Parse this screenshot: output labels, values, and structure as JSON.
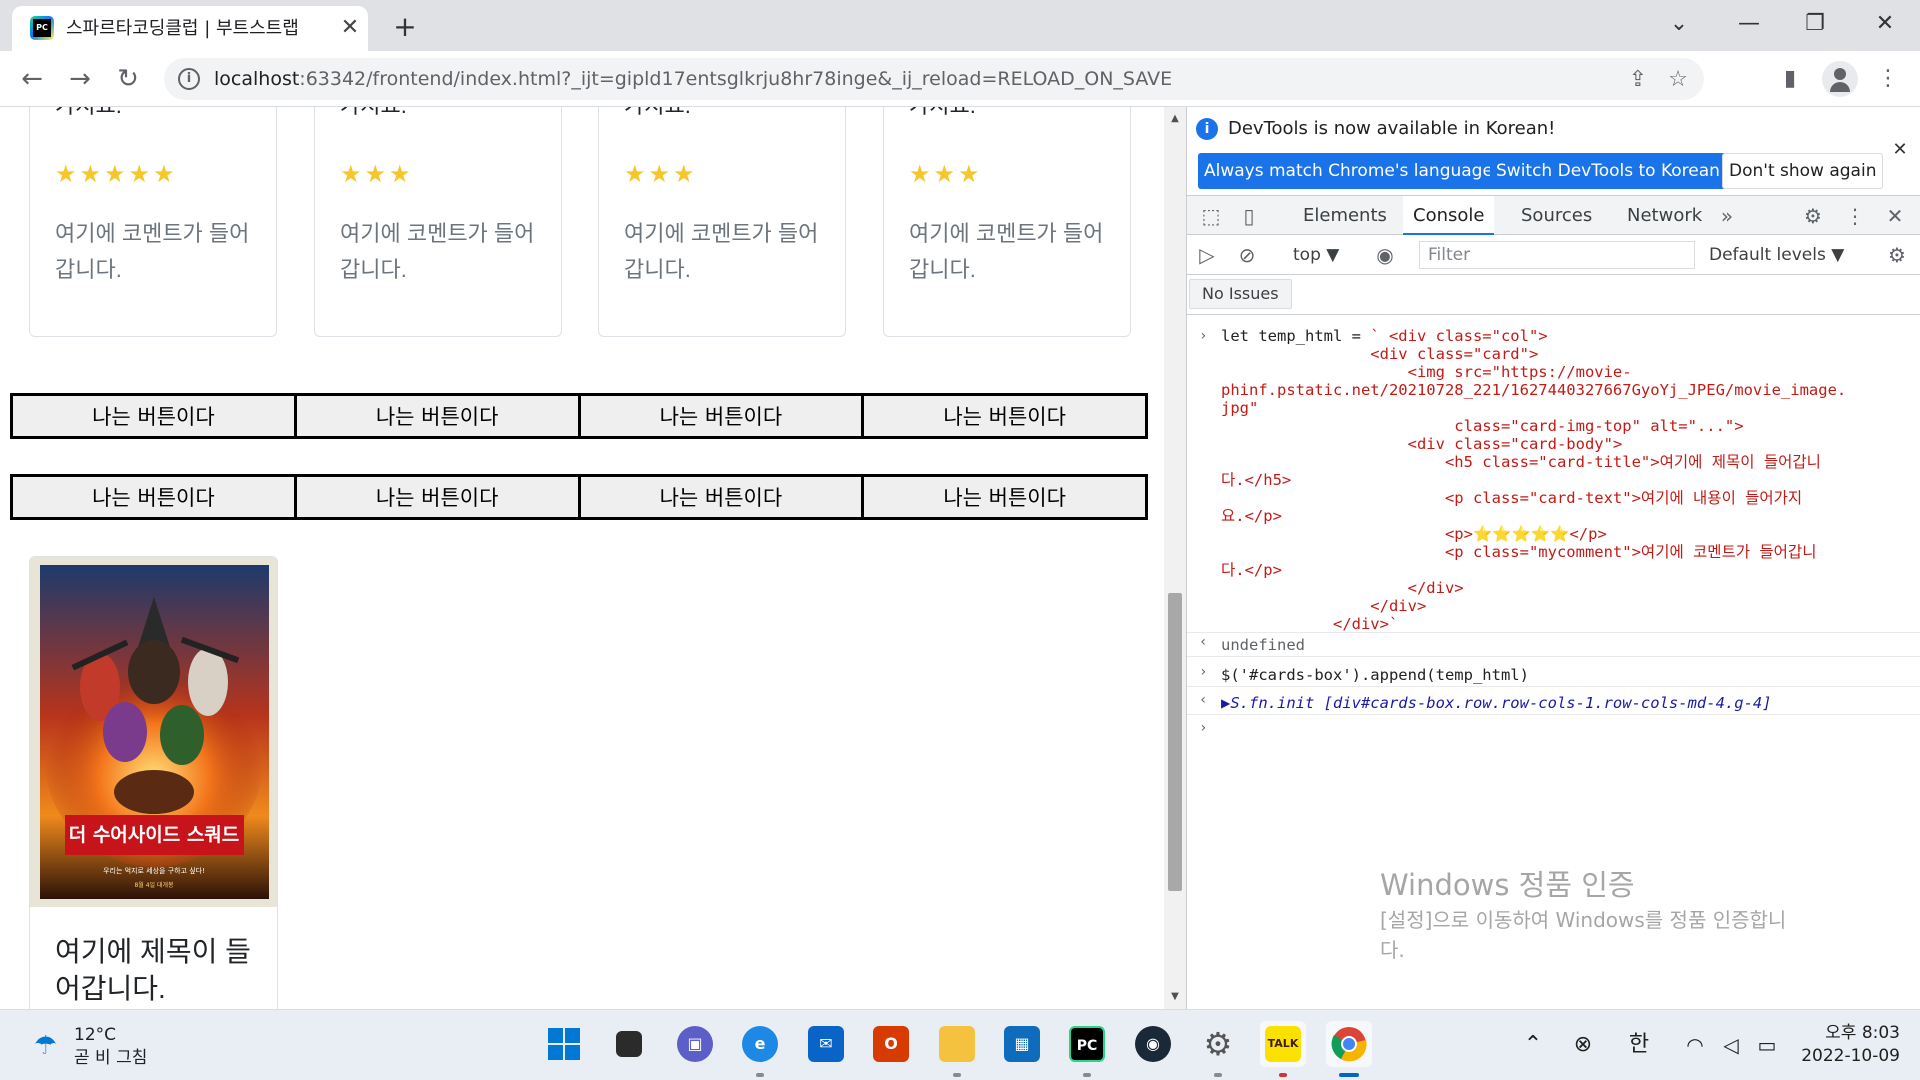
{
  "browser": {
    "tab_title": "스파르타코딩클럽 | 부트스트랩",
    "tab_close": "✕",
    "new_tab": "+",
    "url_host": "localhost",
    "url_rest": ":63342/frontend/index.html?_ijt=gipld17entsglkrju8hr78inge&_ij_reload=RELOAD_ON_SAVE",
    "window_controls": {
      "tabsearch": "⌄",
      "minimize": "—",
      "restore": "❐",
      "close": "✕"
    },
    "nav": {
      "back": "←",
      "forward": "→",
      "reload": "↻"
    }
  },
  "page": {
    "cards": [
      {
        "text_line": "가지요.",
        "stars": "★★★★★",
        "comment": "여기에 코멘트가 들어갑니다."
      },
      {
        "text_line": "가지요.",
        "stars": "★★★",
        "comment": "여기에 코멘트가 들어갑니다."
      },
      {
        "text_line": "가지요.",
        "stars": "★★★",
        "comment": "여기에 코멘트가 들어갑니다."
      },
      {
        "text_line": "가지요.",
        "stars": "★★★",
        "comment": "여기에 코멘트가 들어갑니다."
      }
    ],
    "button_label": "나는 버튼이다",
    "button_rows": [
      [
        "나는 버튼이다",
        "나는 버튼이다",
        "나는 버튼이다",
        "나는 버튼이다"
      ],
      [
        "나는 버튼이다",
        "나는 버튼이다",
        "나는 버튼이다",
        "나는 버튼이다"
      ]
    ],
    "new_card": {
      "title": "여기에 제목이 들어갑니다.",
      "poster": {
        "title_text": "더 수어사이드 스쿼드",
        "tagline": "우리는 억지로 세상을 구하고 싶다!",
        "date": "8월 4일 대개봉"
      }
    }
  },
  "devtools": {
    "banner": {
      "message": "DevTools is now available in Korean!",
      "btn_match": "Always match Chrome's language",
      "btn_switch": "Switch DevTools to Korean",
      "btn_dont_show": "Don't show again"
    },
    "tabs": [
      "Elements",
      "Console",
      "Sources",
      "Network"
    ],
    "active_tab": "Console",
    "more_tabs": "»",
    "context": "top ▼",
    "filter_placeholder": "Filter",
    "levels": "Default levels ▼",
    "issues": "No Issues",
    "console": {
      "entry1_lines": [
        "let temp_html = ` <div class=\"col\">",
        "                <div class=\"card\">",
        "                    <img src=\"https://movie-",
        "phinf.pstatic.net/20210728_221/1627440327667GyoYj_JPEG/movie_image.",
        "jpg\"",
        "                         class=\"card-img-top\" alt=\"...\">",
        "                    <div class=\"card-body\">",
        "                        <h5 class=\"card-title\">여기에 제목이 들어갑니",
        "다.</h5>",
        "                        <p class=\"card-text\">여기에 내용이 들어가지",
        "요.</p>",
        "                        <p>⭐⭐⭐⭐⭐</p>",
        "                        <p class=\"mycomment\">여기에 코멘트가 들어갑니",
        "다.</p>",
        "                    </div>",
        "                </div>",
        "            </div>`"
      ],
      "entry1_result": "undefined",
      "entry2_code": "$('#cards-box').append(temp_html)",
      "entry2_result": "▶S.fn.init [div#cards-box.row.row-cols-1.row-cols-md-4.g-4]"
    }
  },
  "watermark": {
    "title": "Windows 정품 인증",
    "subtitle_line1": "[설정]으로 이동하여 Windows를 정품 인증합니",
    "subtitle_line2": "다."
  },
  "taskbar": {
    "weather_temp": "12°C",
    "weather_cond": "곧 비 그침",
    "ime": "한",
    "time": "오후 8:03",
    "date": "2022-10-09"
  }
}
